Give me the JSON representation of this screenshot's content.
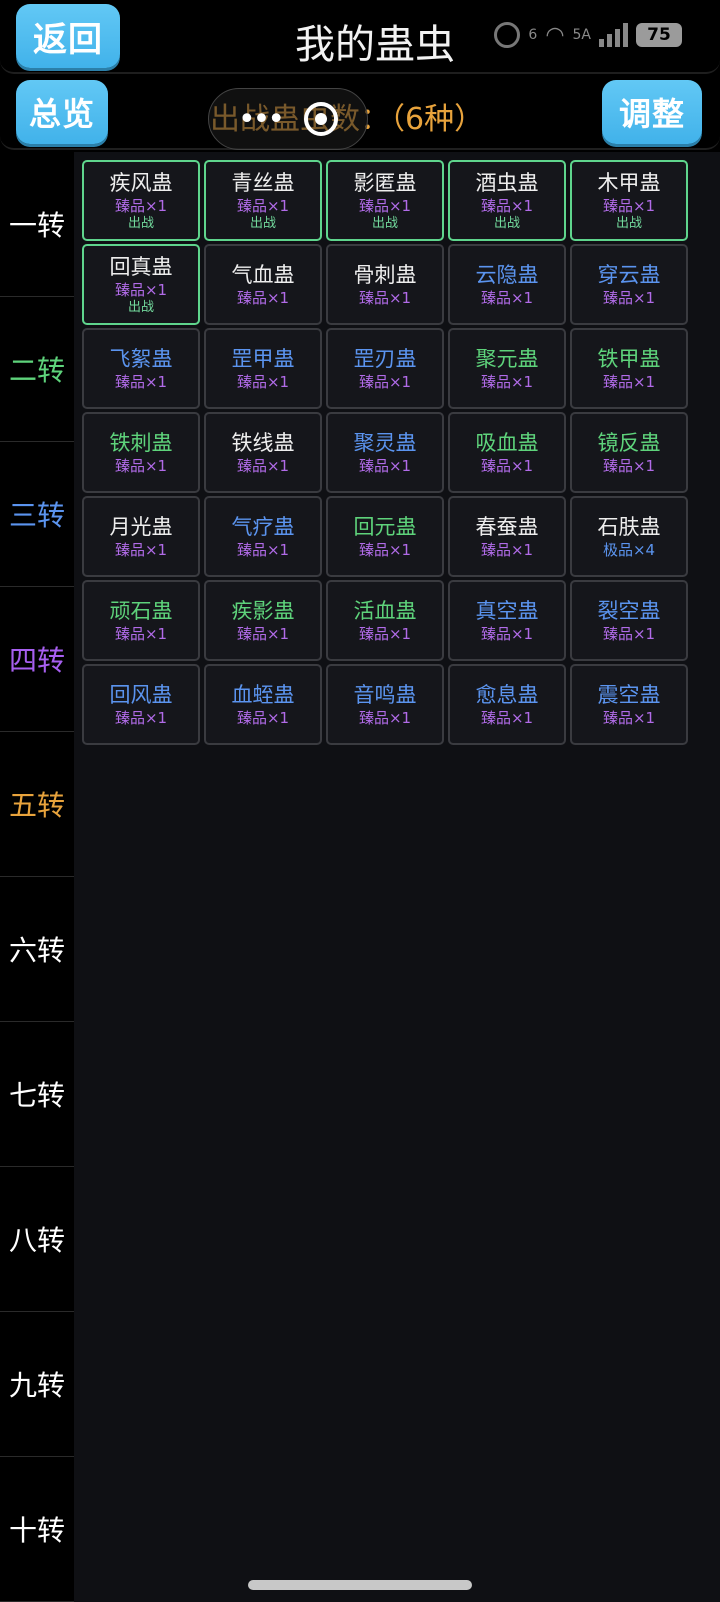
{
  "header": {
    "back_label": "返回",
    "title": "我的蛊虫",
    "status": {
      "wifi_label": "6",
      "network_label": "5A",
      "battery": "75"
    }
  },
  "subheader": {
    "overview_label": "总览",
    "deploy_text": "出战蛊虫数：（6种）",
    "adjust_label": "调整"
  },
  "tiers": [
    {
      "label": "一转",
      "color": "#ffffff"
    },
    {
      "label": "二转",
      "color": "#5ed37b"
    },
    {
      "label": "三转",
      "color": "#5b94ef"
    },
    {
      "label": "四转",
      "color": "#a75ff0"
    },
    {
      "label": "五转",
      "color": "#e8a33c"
    },
    {
      "label": "六转",
      "color": "#ffffff"
    },
    {
      "label": "七转",
      "color": "#ffffff"
    },
    {
      "label": "八转",
      "color": "#ffffff"
    },
    {
      "label": "九转",
      "color": "#ffffff"
    },
    {
      "label": "十转",
      "color": "#ffffff"
    }
  ],
  "gu_list": [
    {
      "name": "疾风蛊",
      "name_color": "#eeeeee",
      "quality": "臻品×1",
      "quality_color": "#b16be8",
      "state": "出战"
    },
    {
      "name": "青丝蛊",
      "name_color": "#eeeeee",
      "quality": "臻品×1",
      "quality_color": "#b16be8",
      "state": "出战"
    },
    {
      "name": "影匿蛊",
      "name_color": "#eeeeee",
      "quality": "臻品×1",
      "quality_color": "#b16be8",
      "state": "出战"
    },
    {
      "name": "酒虫蛊",
      "name_color": "#eeeeee",
      "quality": "臻品×1",
      "quality_color": "#b16be8",
      "state": "出战"
    },
    {
      "name": "木甲蛊",
      "name_color": "#eeeeee",
      "quality": "臻品×1",
      "quality_color": "#b16be8",
      "state": "出战"
    },
    {
      "name": "回真蛊",
      "name_color": "#eeeeee",
      "quality": "臻品×1",
      "quality_color": "#b16be8",
      "state": "出战"
    },
    {
      "name": "气血蛊",
      "name_color": "#eeeeee",
      "quality": "臻品×1",
      "quality_color": "#b16be8",
      "state": ""
    },
    {
      "name": "骨刺蛊",
      "name_color": "#eeeeee",
      "quality": "臻品×1",
      "quality_color": "#b16be8",
      "state": ""
    },
    {
      "name": "云隐蛊",
      "name_color": "#5b94ef",
      "quality": "臻品×1",
      "quality_color": "#b16be8",
      "state": ""
    },
    {
      "name": "穿云蛊",
      "name_color": "#5b94ef",
      "quality": "臻品×1",
      "quality_color": "#b16be8",
      "state": ""
    },
    {
      "name": "飞絮蛊",
      "name_color": "#5b94ef",
      "quality": "臻品×1",
      "quality_color": "#b16be8",
      "state": ""
    },
    {
      "name": "罡甲蛊",
      "name_color": "#5b94ef",
      "quality": "臻品×1",
      "quality_color": "#b16be8",
      "state": ""
    },
    {
      "name": "罡刃蛊",
      "name_color": "#5b94ef",
      "quality": "臻品×1",
      "quality_color": "#b16be8",
      "state": ""
    },
    {
      "name": "聚元蛊",
      "name_color": "#5ed37b",
      "quality": "臻品×1",
      "quality_color": "#b16be8",
      "state": ""
    },
    {
      "name": "铁甲蛊",
      "name_color": "#5ed37b",
      "quality": "臻品×1",
      "quality_color": "#b16be8",
      "state": ""
    },
    {
      "name": "铁刺蛊",
      "name_color": "#5ed37b",
      "quality": "臻品×1",
      "quality_color": "#b16be8",
      "state": ""
    },
    {
      "name": "铁线蛊",
      "name_color": "#eeeeee",
      "quality": "臻品×1",
      "quality_color": "#b16be8",
      "state": ""
    },
    {
      "name": "聚灵蛊",
      "name_color": "#5b94ef",
      "quality": "臻品×1",
      "quality_color": "#b16be8",
      "state": ""
    },
    {
      "name": "吸血蛊",
      "name_color": "#5ed37b",
      "quality": "臻品×1",
      "quality_color": "#b16be8",
      "state": ""
    },
    {
      "name": "镜反蛊",
      "name_color": "#5ed37b",
      "quality": "臻品×1",
      "quality_color": "#b16be8",
      "state": ""
    },
    {
      "name": "月光蛊",
      "name_color": "#eeeeee",
      "quality": "臻品×1",
      "quality_color": "#b16be8",
      "state": ""
    },
    {
      "name": "气疗蛊",
      "name_color": "#5b94ef",
      "quality": "臻品×1",
      "quality_color": "#b16be8",
      "state": ""
    },
    {
      "name": "回元蛊",
      "name_color": "#5ed37b",
      "quality": "臻品×1",
      "quality_color": "#b16be8",
      "state": ""
    },
    {
      "name": "春蚕蛊",
      "name_color": "#eeeeee",
      "quality": "臻品×1",
      "quality_color": "#b16be8",
      "state": ""
    },
    {
      "name": "石肤蛊",
      "name_color": "#eeeeee",
      "quality": "极品×4",
      "quality_color": "#5b94ef",
      "state": ""
    },
    {
      "name": "顽石蛊",
      "name_color": "#5ed37b",
      "quality": "臻品×1",
      "quality_color": "#b16be8",
      "state": ""
    },
    {
      "name": "疾影蛊",
      "name_color": "#5ed37b",
      "quality": "臻品×1",
      "quality_color": "#b16be8",
      "state": ""
    },
    {
      "name": "活血蛊",
      "name_color": "#5ed37b",
      "quality": "臻品×1",
      "quality_color": "#b16be8",
      "state": ""
    },
    {
      "name": "真空蛊",
      "name_color": "#5b94ef",
      "quality": "臻品×1",
      "quality_color": "#b16be8",
      "state": ""
    },
    {
      "name": "裂空蛊",
      "name_color": "#5b94ef",
      "quality": "臻品×1",
      "quality_color": "#b16be8",
      "state": ""
    },
    {
      "name": "回风蛊",
      "name_color": "#5b94ef",
      "quality": "臻品×1",
      "quality_color": "#b16be8",
      "state": ""
    },
    {
      "name": "血蛭蛊",
      "name_color": "#5b94ef",
      "quality": "臻品×1",
      "quality_color": "#b16be8",
      "state": ""
    },
    {
      "name": "音鸣蛊",
      "name_color": "#5b94ef",
      "quality": "臻品×1",
      "quality_color": "#b16be8",
      "state": ""
    },
    {
      "name": "愈息蛊",
      "name_color": "#5b94ef",
      "quality": "臻品×1",
      "quality_color": "#b16be8",
      "state": ""
    },
    {
      "name": "震空蛊",
      "name_color": "#5b94ef",
      "quality": "臻品×1",
      "quality_color": "#b16be8",
      "state": ""
    }
  ]
}
